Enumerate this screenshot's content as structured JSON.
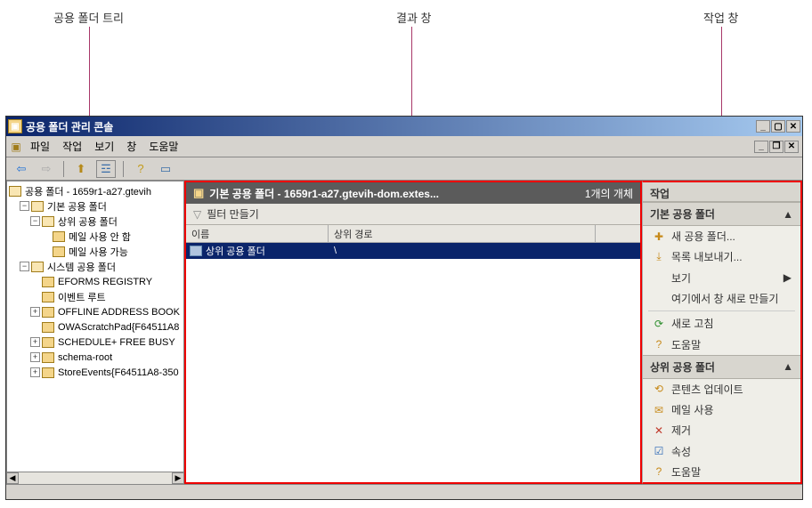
{
  "diagram_labels": {
    "left": "공용 폴더 트리",
    "mid": "결과 창",
    "right": "작업 창"
  },
  "window": {
    "title": "공용 폴더 관리 콘솔"
  },
  "menu": {
    "file": "파일",
    "action": "작업",
    "view": "보기",
    "window": "창",
    "help": "도움말"
  },
  "tree": {
    "root": "공용 폴더 - 1659r1-a27.gtevih",
    "basic": "기본 공용 폴더",
    "upper": "상위 공용 폴더",
    "mail_disabled": "메일 사용 안 함",
    "mail_enabled": "메일 사용 가능",
    "system": "시스템 공용 폴더",
    "eforms": "EFORMS REGISTRY",
    "event_root": "이벤트 루트",
    "oab": "OFFLINE ADDRESS BOOK",
    "owa": "OWAScratchPad{F64511A8",
    "sched": "SCHEDULE+ FREE BUSY",
    "schema": "schema-root",
    "store": "StoreEvents{F64511A8-350"
  },
  "mid": {
    "title": "기본 공용 폴더 - 1659r1-a27.gtevih-dom.extes...",
    "count": "1개의 개체",
    "filter": "필터 만들기",
    "col_name": "이름",
    "col_path": "상위 경로",
    "row_name": "상위 공용 폴더",
    "row_path": "\\"
  },
  "actions": {
    "head": "작업",
    "sec1": "기본 공용 폴더",
    "new_folder": "새 공용 폴더...",
    "export_list": "목록 내보내기...",
    "view": "보기",
    "new_window": "여기에서 창 새로 만들기",
    "refresh": "새로 고침",
    "help1": "도움말",
    "sec2": "상위 공용 폴더",
    "update_content": "콘텐츠 업데이트",
    "mail_enable": "메일 사용",
    "remove": "제거",
    "properties": "속성",
    "help2": "도움말"
  }
}
